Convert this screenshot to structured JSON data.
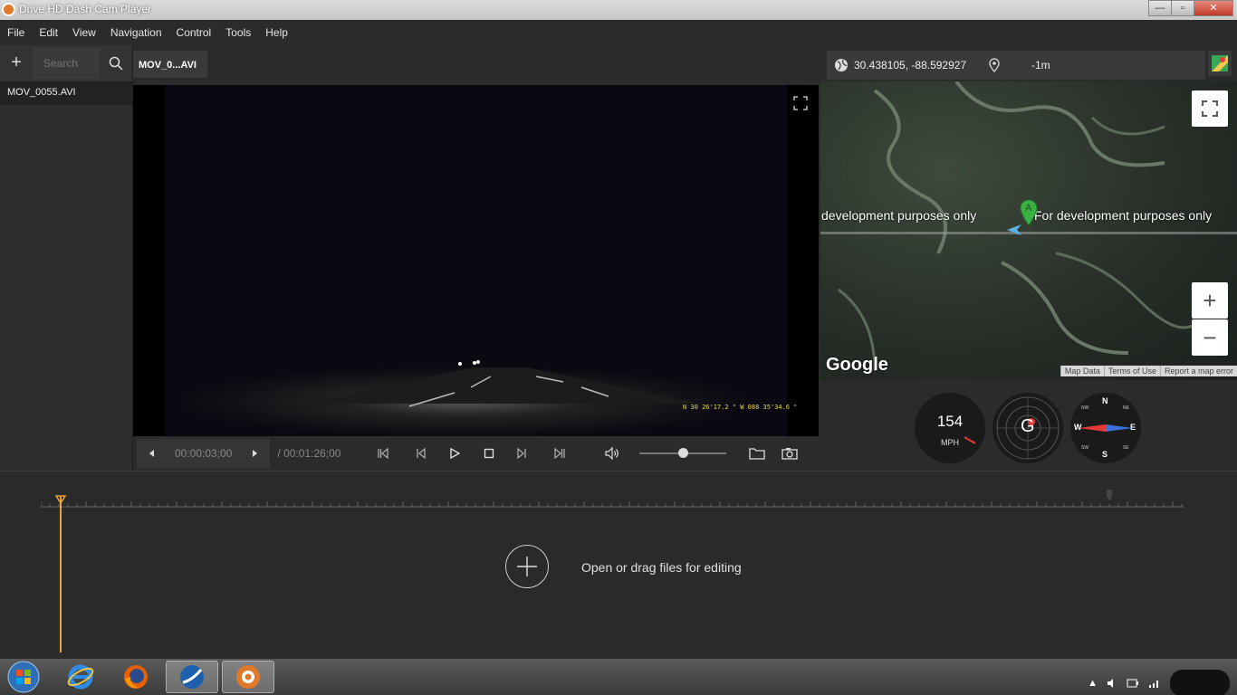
{
  "window": {
    "title": "Drive HD Dash Cam Player"
  },
  "menu": [
    "File",
    "Edit",
    "View",
    "Navigation",
    "Control",
    "Tools",
    "Help"
  ],
  "sidebar": {
    "search_placeholder": "Search",
    "files": [
      "MOV_0055.AVI"
    ]
  },
  "player": {
    "tab_label": "MOV_0...AVI",
    "current_time": "00:00:03;00",
    "total_time": "/ 00:01:26;00",
    "volume_fraction": 0.5,
    "gps_overlay": "N 30 26'17.2 \"  W 088 35'34.6 \""
  },
  "map": {
    "coordinates": "30.438105, -88.592927",
    "altitude": "-1m",
    "watermark_left": "development purposes only",
    "watermark_right": "For development purposes only",
    "marker_label": "A",
    "google_label": "Google",
    "footer": [
      "Map Data",
      "Terms of Use",
      "Report a map error"
    ],
    "zoom_in": "+",
    "zoom_out": "−"
  },
  "gauges": {
    "speed": "154",
    "speed_unit": "MPH",
    "gsensor_label": "G",
    "compass": {
      "n": "N",
      "s": "S",
      "e": "E",
      "w": "W",
      "nw": "NW",
      "ne": "NE",
      "sw": "SW",
      "se": "SE"
    }
  },
  "timeline": {
    "drop_text": "Open or drag files for editing"
  },
  "colors": {
    "playhead": "#e8a33a",
    "overlay_text": "#e8d840",
    "map_marker": "#3cb043"
  }
}
